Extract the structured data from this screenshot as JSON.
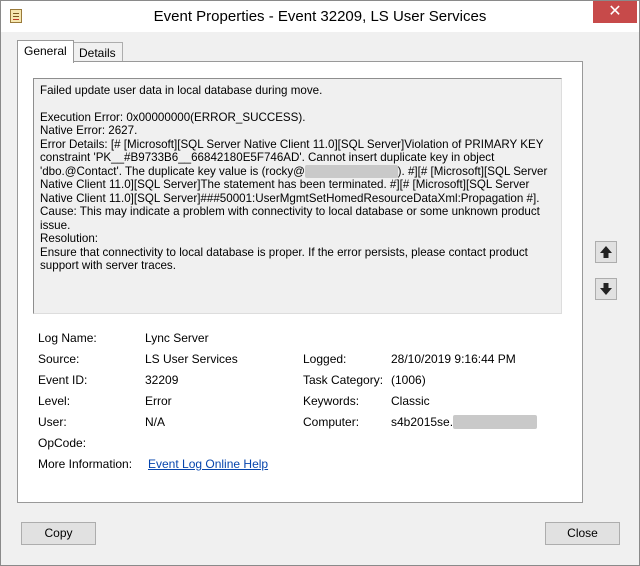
{
  "window": {
    "title": "Event Properties - Event 32209, LS User Services",
    "close_glyph": "✕"
  },
  "tabs": [
    {
      "label": "General",
      "active": true
    },
    {
      "label": "Details",
      "active": false
    }
  ],
  "message": {
    "line1": "Failed update user data in local database during move.",
    "execution_error": "Execution Error: 0x00000000(ERROR_SUCCESS).",
    "native_error": "Native Error: 2627.",
    "details_a": "Error Details: [# [Microsoft][SQL Server Native Client 11.0][SQL Server]Violation of PRIMARY KEY constraint 'PK__#B9733B6__66842180E5F746AD'. Cannot insert duplicate key in object 'dbo.@Contact'. The duplicate key value is (rocky@",
    "redacted_email": "xxxxxxxxxxxxxxxx",
    "details_b": "). #][# [Microsoft][SQL Server Native Client 11.0][SQL Server]The statement has been terminated. #][# [Microsoft][SQL Server Native Client 11.0][SQL Server]###50001:UserMgmtSetHomedResourceDataXml:Propagation #].",
    "cause": "Cause: This may indicate a problem with connectivity to local database or some unknown product issue.",
    "resolution_label": "Resolution:",
    "resolution": "Ensure that connectivity to local database is proper. If the error persists, please contact product support with server traces."
  },
  "properties": {
    "log_name_label": "Log Name:",
    "log_name": "Lync Server",
    "source_label": "Source:",
    "source": "LS User Services",
    "logged_label": "Logged:",
    "logged": "28/10/2019 9:16:44 PM",
    "event_id_label": "Event ID:",
    "event_id": "32209",
    "task_category_label": "Task Category:",
    "task_category": "(1006)",
    "level_label": "Level:",
    "level": "Error",
    "keywords_label": "Keywords:",
    "keywords": "Classic",
    "user_label": "User:",
    "user": "N/A",
    "computer_label": "Computer:",
    "computer": "s4b2015se.",
    "computer_redacted": "xxxxxxxxxxxxxx",
    "opcode_label": "OpCode:",
    "opcode": "",
    "more_info_label": "More Information:",
    "more_info_link": "Event Log Online Help"
  },
  "buttons": {
    "copy": "Copy",
    "close": "Close"
  },
  "icons": {
    "scroll_up": "arrow-up-icon",
    "scroll_down": "arrow-down-icon",
    "app": "event-log-icon"
  }
}
